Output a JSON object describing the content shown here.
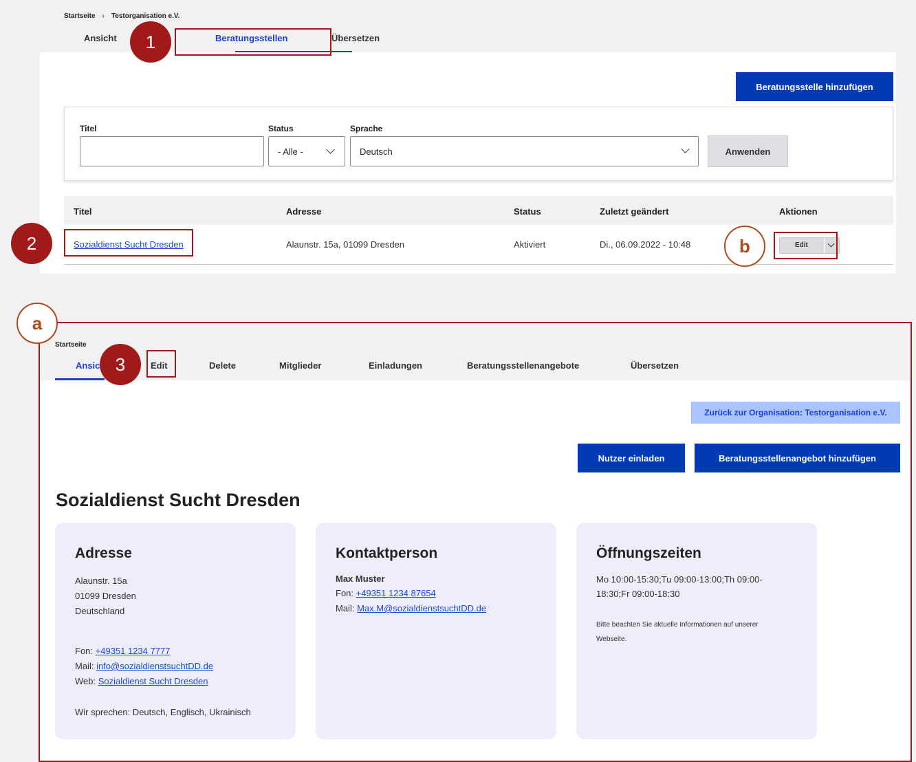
{
  "top": {
    "breadcrumb": [
      "Startseite",
      "Testorganisation e.V."
    ],
    "breadcrumb_sep": "›",
    "tabs": [
      "Ansicht",
      "Beratungsstellen",
      "Übersetzen"
    ],
    "add_button": "Beratungsstelle hinzufügen",
    "filter": {
      "title_label": "Titel",
      "title_value": "",
      "status_label": "Status",
      "status_value": "- Alle -",
      "language_label": "Sprache",
      "language_value": "Deutsch",
      "apply": "Anwenden"
    },
    "table": {
      "headers": [
        "Titel",
        "Adresse",
        "Status",
        "Zuletzt geändert",
        "Aktionen"
      ],
      "rows": [
        {
          "title": "Sozialdienst Sucht Dresden",
          "address": "Alaunstr. 15a, 01099 Dresden",
          "status": "Aktiviert",
          "modified": "Di., 06.09.2022 - 10:48",
          "action": "Edit"
        }
      ]
    }
  },
  "annotations": {
    "one": "1",
    "two": "2",
    "three": "3",
    "a": "a",
    "b": "b"
  },
  "detail": {
    "breadcrumb": "Startseite",
    "tabs": [
      "Ansicht",
      "Edit",
      "Delete",
      "Mitglieder",
      "Einladungen",
      "Beratungsstellenangebote",
      "Übersetzen"
    ],
    "back_button": "Zurück zur Organisation: Testorganisation e.V.",
    "invite_button": "Nutzer einladen",
    "add_offer_button": "Beratungsstellenangebot hinzufügen",
    "title": "Sozialdienst Sucht Dresden",
    "address_card": {
      "heading": "Adresse",
      "street": "Alaunstr. 15a",
      "city": "01099 Dresden",
      "country": "Deutschland",
      "phone_label": "Fon:",
      "phone": "+49351 1234 7777",
      "mail_label": "Mail:",
      "mail": "info@sozialdienstsuchtDD.de",
      "web_label": "Web:",
      "web": "Sozialdienst Sucht Dresden",
      "languages": "Wir sprechen: Deutsch, Englisch, Ukrainisch"
    },
    "contact_card": {
      "heading": "Kontaktperson",
      "name": "Max Muster",
      "phone_label": "Fon:",
      "phone": "+49351 1234 87654",
      "mail_label": "Mail:",
      "mail": "Max.M@sozialdienstsuchtDD.de"
    },
    "hours_card": {
      "heading": "Öffnungszeiten",
      "hours_line1": "Mo 10:00-15:30;Tu 09:00-13:00;Th 09:00-",
      "hours_line2": "18:30;Fr 09:00-18:30",
      "note_line1": "Bitte beachten Sie aktuelle Informationen auf unserer",
      "note_line2": "Webseite."
    }
  },
  "colors": {
    "primary": "#003bb5",
    "annotation": "#a11a1a",
    "card_bg": "#ededfb"
  }
}
